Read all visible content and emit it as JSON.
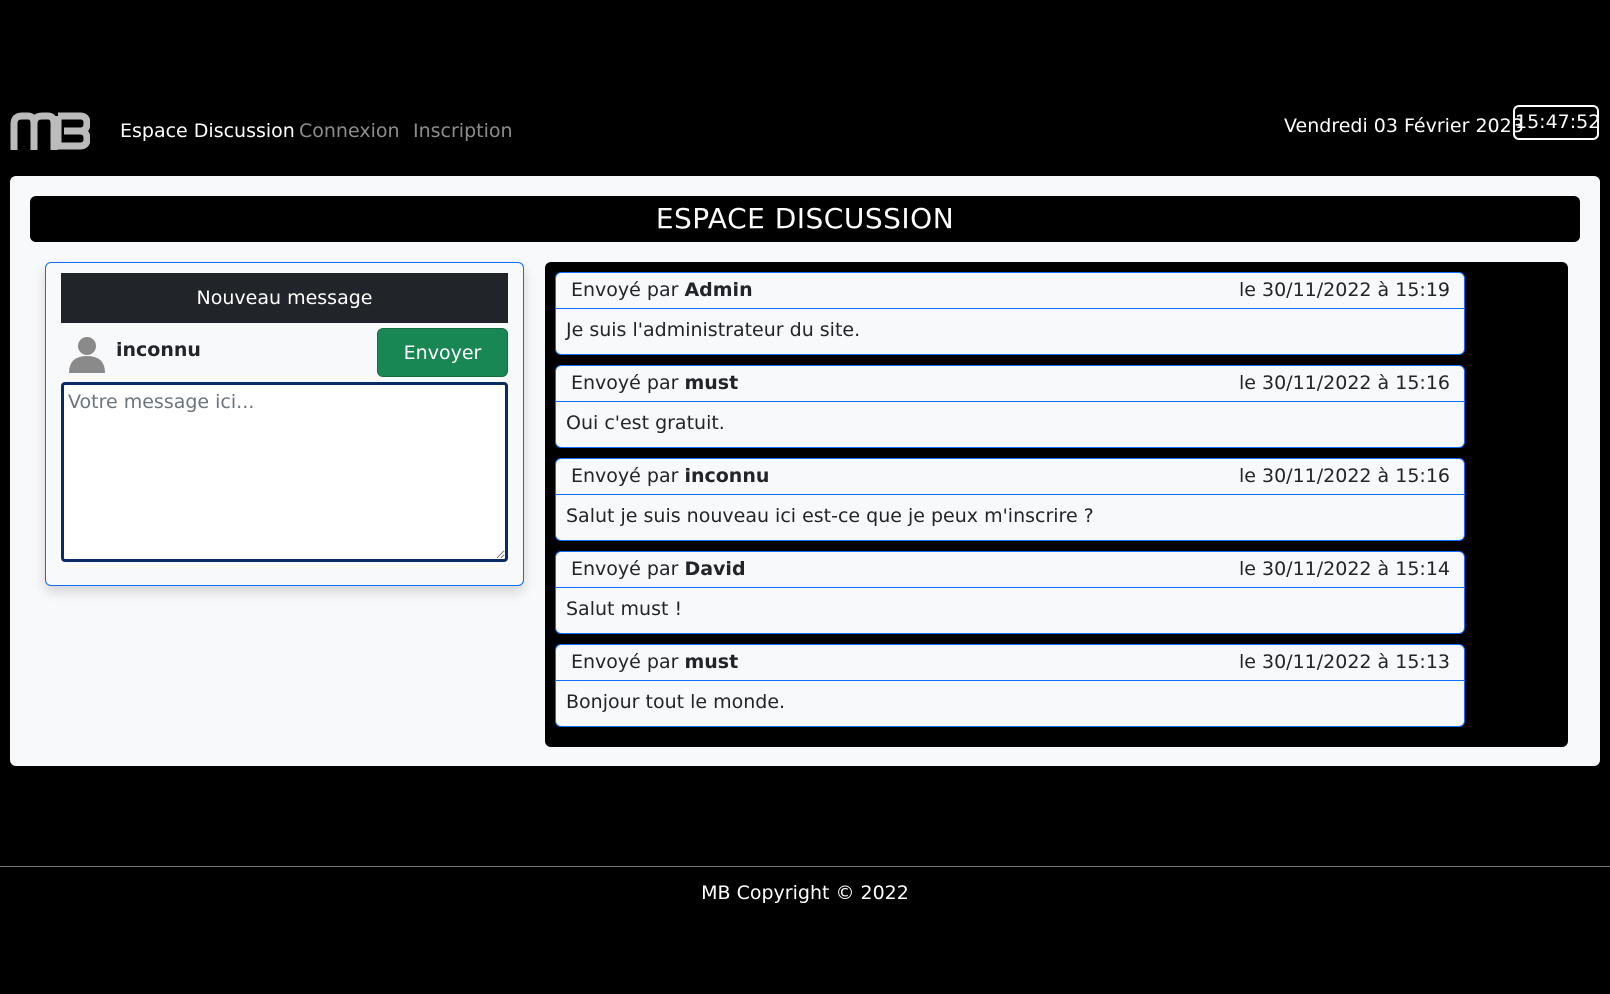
{
  "navbar": {
    "logo_text": "MB",
    "links": [
      {
        "label": "Espace Discussion",
        "active": true
      },
      {
        "label": "Connexion",
        "active": false
      },
      {
        "label": "Inscription",
        "active": false
      }
    ],
    "date": "Vendredi 03 Février 2023",
    "time": "15:47:52"
  },
  "page": {
    "title": "ESPACE DISCUSSION"
  },
  "compose": {
    "header": "Nouveau message",
    "username": "inconnu",
    "send_label": "Envoyer",
    "placeholder": "Votre message ici..."
  },
  "messages": [
    {
      "prefix": "Envoyé par",
      "author": "Admin",
      "date": "le 30/11/2022 à 15:19",
      "text": "Je suis l'administrateur du site."
    },
    {
      "prefix": "Envoyé par",
      "author": "must",
      "date": "le 30/11/2022 à 15:16",
      "text": "Oui c'est gratuit."
    },
    {
      "prefix": "Envoyé par",
      "author": "inconnu",
      "date": "le 30/11/2022 à 15:16",
      "text": "Salut je suis nouveau ici est-ce que je peux m'inscrire ?"
    },
    {
      "prefix": "Envoyé par",
      "author": "David",
      "date": "le 30/11/2022 à 15:14",
      "text": "Salut must !"
    },
    {
      "prefix": "Envoyé par",
      "author": "must",
      "date": "le 30/11/2022 à 15:13",
      "text": "Bonjour tout le monde."
    }
  ],
  "footer": {
    "text": "MB Copyright © 2022"
  },
  "colors": {
    "background": "#000000",
    "panel": "#f8f9fa",
    "accent_blue": "#0d6efd",
    "send_green": "#198754",
    "dark_header": "#212529"
  }
}
